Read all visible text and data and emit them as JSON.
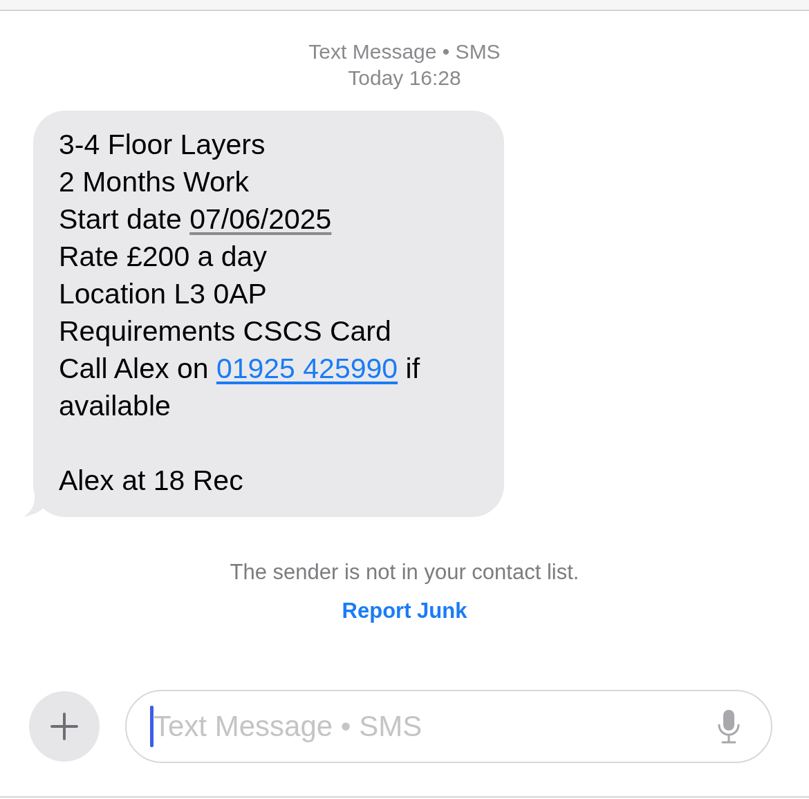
{
  "header": {
    "service": "Text Message • SMS",
    "time": "Today 16:28"
  },
  "message": {
    "blocks": [
      [
        [
          {
            "kind": "plain",
            "text": "3-4 Floor Layers"
          }
        ],
        [
          {
            "kind": "plain",
            "text": "2 Months Work"
          }
        ],
        [
          {
            "kind": "plain",
            "text": "Start date "
          },
          {
            "kind": "date",
            "text": "07/06/2025"
          }
        ],
        [
          {
            "kind": "plain",
            "text": "Rate £200 a day"
          }
        ],
        [
          {
            "kind": "plain",
            "text": "Location L3 0AP"
          }
        ],
        [
          {
            "kind": "plain",
            "text": "Requirements CSCS Card"
          }
        ],
        [
          {
            "kind": "plain",
            "text": "Call Alex on "
          },
          {
            "kind": "phone",
            "text": "01925 425990"
          },
          {
            "kind": "plain",
            "text": " if available"
          }
        ]
      ],
      [
        [
          {
            "kind": "plain",
            "text": "Alex at 18 Rec"
          }
        ]
      ]
    ]
  },
  "notice": {
    "text": "The sender is not in your contact list.",
    "action": "Report Junk"
  },
  "composer": {
    "placeholder": "Text Message • SMS",
    "focused": true
  }
}
